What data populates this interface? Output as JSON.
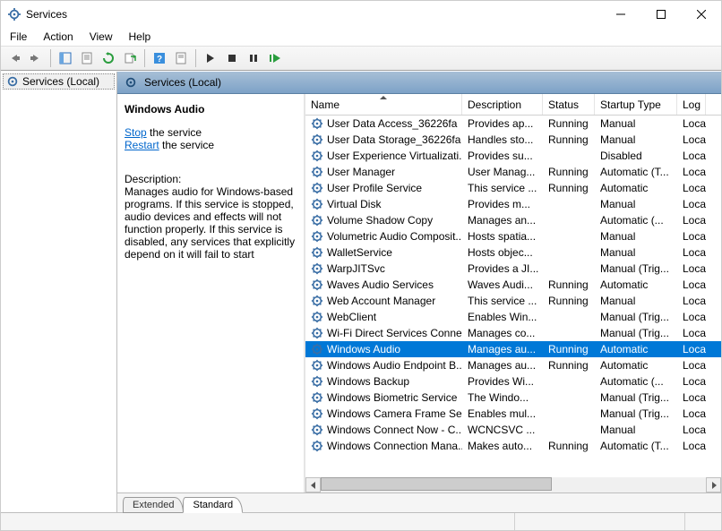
{
  "window": {
    "title": "Services"
  },
  "menus": [
    "File",
    "Action",
    "View",
    "Help"
  ],
  "tree": {
    "root_label": "Services (Local)"
  },
  "right_header": {
    "label": "Services (Local)"
  },
  "detail": {
    "service_name": "Windows Audio",
    "action_stop": "Stop",
    "action_stop_suffix": " the service",
    "action_restart": "Restart",
    "action_restart_suffix": " the service",
    "desc_label": "Description:",
    "description": "Manages audio for Windows-based programs.  If this service is stopped, audio devices and effects will not function properly.  If this service is disabled, any services that explicitly depend on it will fail to start"
  },
  "columns": {
    "name": "Name",
    "description": "Description",
    "status": "Status",
    "startup": "Startup Type",
    "logon": "Log"
  },
  "tabs": {
    "extended": "Extended",
    "standard": "Standard"
  },
  "rows": [
    {
      "name": "User Data Access_36226fa",
      "desc": "Provides ap...",
      "status": "Running",
      "startup": "Manual",
      "log": "Loca"
    },
    {
      "name": "User Data Storage_36226fa",
      "desc": "Handles sto...",
      "status": "Running",
      "startup": "Manual",
      "log": "Loca"
    },
    {
      "name": "User Experience Virtualizati...",
      "desc": "Provides su...",
      "status": "",
      "startup": "Disabled",
      "log": "Loca"
    },
    {
      "name": "User Manager",
      "desc": "User Manag...",
      "status": "Running",
      "startup": "Automatic (T...",
      "log": "Loca"
    },
    {
      "name": "User Profile Service",
      "desc": "This service ...",
      "status": "Running",
      "startup": "Automatic",
      "log": "Loca"
    },
    {
      "name": "Virtual Disk",
      "desc": "Provides m...",
      "status": "",
      "startup": "Manual",
      "log": "Loca"
    },
    {
      "name": "Volume Shadow Copy",
      "desc": "Manages an...",
      "status": "",
      "startup": "Automatic (...",
      "log": "Loca"
    },
    {
      "name": "Volumetric Audio Composit...",
      "desc": "Hosts spatia...",
      "status": "",
      "startup": "Manual",
      "log": "Loca"
    },
    {
      "name": "WalletService",
      "desc": "Hosts objec...",
      "status": "",
      "startup": "Manual",
      "log": "Loca"
    },
    {
      "name": "WarpJITSvc",
      "desc": "Provides a JI...",
      "status": "",
      "startup": "Manual (Trig...",
      "log": "Loca"
    },
    {
      "name": "Waves Audio Services",
      "desc": "Waves Audi...",
      "status": "Running",
      "startup": "Automatic",
      "log": "Loca"
    },
    {
      "name": "Web Account Manager",
      "desc": "This service ...",
      "status": "Running",
      "startup": "Manual",
      "log": "Loca"
    },
    {
      "name": "WebClient",
      "desc": "Enables Win...",
      "status": "",
      "startup": "Manual (Trig...",
      "log": "Loca"
    },
    {
      "name": "Wi-Fi Direct Services Conne...",
      "desc": "Manages co...",
      "status": "",
      "startup": "Manual (Trig...",
      "log": "Loca"
    },
    {
      "name": "Windows Audio",
      "desc": "Manages au...",
      "status": "Running",
      "startup": "Automatic",
      "log": "Loca",
      "selected": true
    },
    {
      "name": "Windows Audio Endpoint B...",
      "desc": "Manages au...",
      "status": "Running",
      "startup": "Automatic",
      "log": "Loca"
    },
    {
      "name": "Windows Backup",
      "desc": "Provides Wi...",
      "status": "",
      "startup": "Automatic (...",
      "log": "Loca"
    },
    {
      "name": "Windows Biometric Service",
      "desc": "The Windo...",
      "status": "",
      "startup": "Manual (Trig...",
      "log": "Loca"
    },
    {
      "name": "Windows Camera Frame Se...",
      "desc": "Enables mul...",
      "status": "",
      "startup": "Manual (Trig...",
      "log": "Loca"
    },
    {
      "name": "Windows Connect Now - C...",
      "desc": "WCNCSVC ...",
      "status": "",
      "startup": "Manual",
      "log": "Loca"
    },
    {
      "name": "Windows Connection Mana...",
      "desc": "Makes auto...",
      "status": "Running",
      "startup": "Automatic (T...",
      "log": "Loca"
    }
  ]
}
